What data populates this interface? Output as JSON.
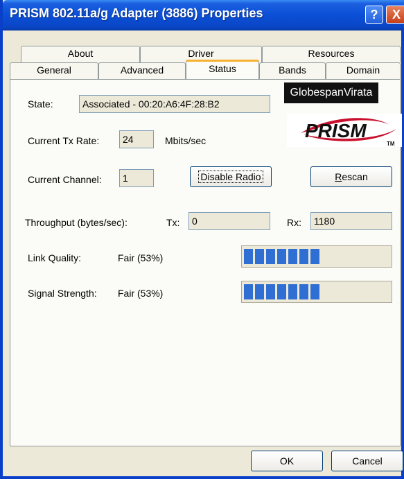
{
  "window": {
    "title": "PRISM 802.11a/g Adapter (3886) Properties",
    "help_glyph": "?",
    "close_glyph": "X"
  },
  "tabs_row_back": [
    "About",
    "Driver",
    "Resources"
  ],
  "tabs_row_front": [
    "General",
    "Advanced",
    "Status",
    "Bands",
    "Domain"
  ],
  "active_tab": "Status",
  "status": {
    "state_label": "State:",
    "state_value": "Associated - 00:20:A6:4F:28:B2",
    "tx_rate_label": "Current Tx Rate:",
    "tx_rate_value": "24",
    "tx_rate_unit": "Mbits/sec",
    "channel_label": "Current Channel:",
    "channel_value": "1",
    "disable_radio": "Disable Radio",
    "rescan_first": "R",
    "rescan_rest": "escan",
    "throughput_label": "Throughput (bytes/sec):",
    "tx_label": "Tx:",
    "tx_value": "0",
    "rx_label": "Rx:",
    "rx_value": "1180",
    "link_quality_label": "Link Quality:",
    "link_quality_value": "Fair (53%)",
    "link_quality_fraction": 0.53,
    "signal_strength_label": "Signal Strength:",
    "signal_strength_value": "Fair (53%)",
    "signal_strength_fraction": 0.53
  },
  "logos": {
    "globespan": "GlobespanVirata",
    "prism": "PRISM",
    "tm": "TM"
  },
  "footer": {
    "ok": "OK",
    "cancel": "Cancel"
  },
  "colors": {
    "title_blue": "#0a4fd6",
    "active_tab_accent": "#f7b030",
    "bar_fill": "#2f6fd3"
  }
}
